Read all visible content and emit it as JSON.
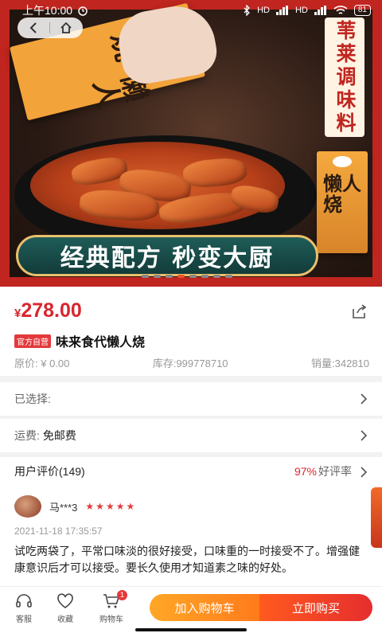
{
  "status_bar": {
    "time": "上午10:00",
    "network_1": "HD",
    "network_2": "HD",
    "battery": "81"
  },
  "hero": {
    "vertical_title": "苇莱调味料",
    "banner_text": "经典配方 秒变大厨",
    "packet_left_text": "懒人烧",
    "packet_right_text": "懒人烧",
    "carousel_count": 8,
    "carousel_active": 4
  },
  "product": {
    "currency": "¥",
    "price": "278.00",
    "badge": "官方自营",
    "title": "味来食代懒人烧",
    "original_price": "原价: ¥ 0.00",
    "stock": "库存:999778710",
    "sales": "销量:342810"
  },
  "selection": {
    "label": "已选择:",
    "value": ""
  },
  "shipping": {
    "label": "运费:",
    "value": "免邮费"
  },
  "reviews": {
    "header": "用户评价(149)",
    "positive_pct": "97%",
    "positive_label": "好评率",
    "user": "马***3",
    "stars": "★★★★★",
    "date": "2021-11-18 17:35:57",
    "text": "试吃两袋了，平常口味淡的很好接受，口味重的一时接受不了。增强健康意识后才可以接受。要长久使用才知道素之味的好处。"
  },
  "bottom_bar": {
    "service": "客服",
    "favorite": "收藏",
    "cart": "购物车",
    "cart_count": "1",
    "add_to_cart": "加入购物车",
    "buy_now": "立即购买"
  },
  "colors": {
    "accent_red": "#d9252e",
    "orange": "#ff7b1c"
  }
}
